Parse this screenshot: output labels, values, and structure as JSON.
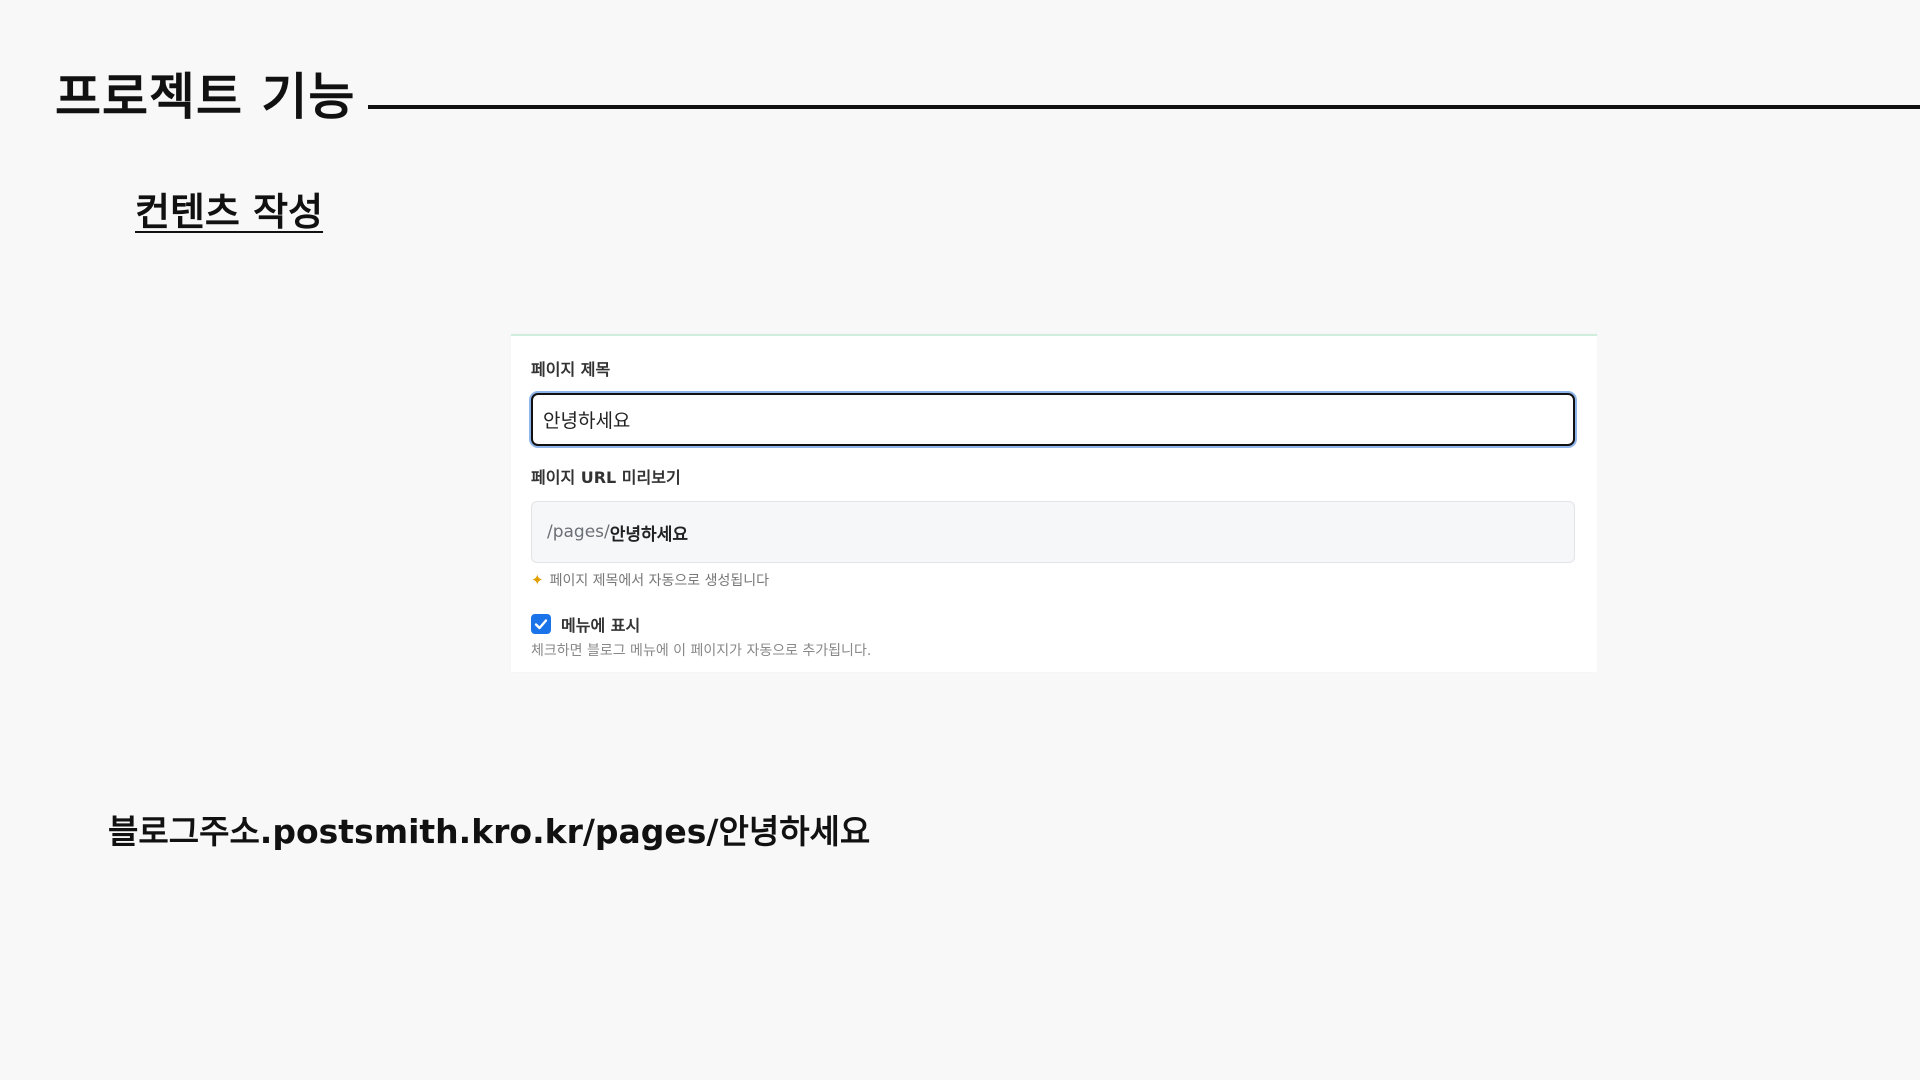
{
  "slide": {
    "title": "프로젝트 기능",
    "section_heading": "컨텐츠 작성",
    "blog_url": "블로그주소.postsmith.kro.kr/pages/안녕하세요"
  },
  "form": {
    "page_title_label": "페이지 제목",
    "page_title_value": "안녕하세요",
    "url_preview_label": "페이지 URL 미리보기",
    "url_prefix": "/pages/",
    "url_slug": "안녕하세요",
    "auto_generate_hint": "페이지 제목에서 자동으로 생성됩니다",
    "hint_icon": "sparkle-icon",
    "show_in_menu_label": "메뉴에 표시",
    "show_in_menu_checked": true,
    "show_in_menu_help": "체크하면 블로그 메뉴에 이 페이지가 자동으로 추가됩니다."
  },
  "colors": {
    "accent": "#1a73e8",
    "focus_ring": "#8fb5ea",
    "background": "#f8f8f8"
  }
}
